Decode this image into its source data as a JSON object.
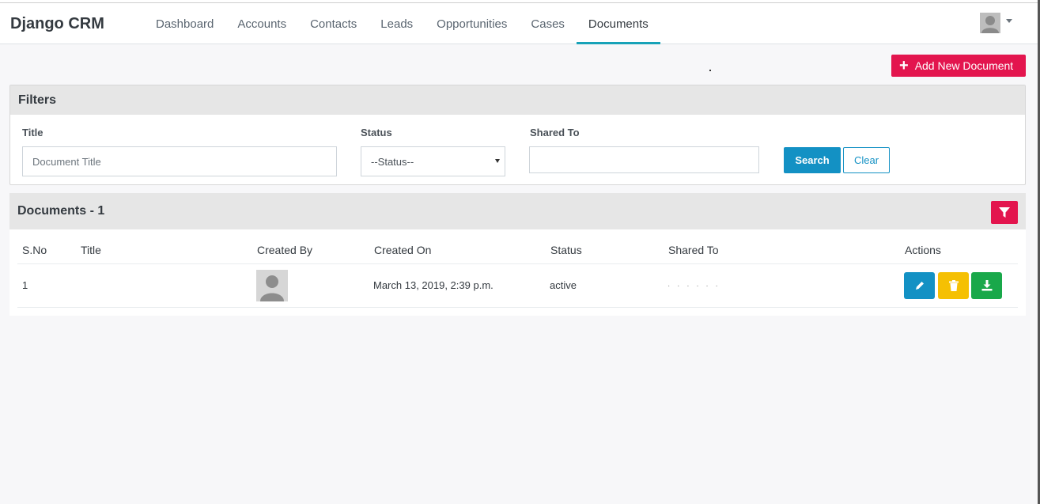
{
  "navbar": {
    "brand": "Django CRM",
    "items": [
      {
        "label": "Dashboard",
        "active": false
      },
      {
        "label": "Accounts",
        "active": false
      },
      {
        "label": "Contacts",
        "active": false
      },
      {
        "label": "Leads",
        "active": false
      },
      {
        "label": "Opportunities",
        "active": false
      },
      {
        "label": "Cases",
        "active": false
      },
      {
        "label": "Documents",
        "active": true
      }
    ]
  },
  "actions": {
    "add_document_label": "Add New Document",
    "add_icon": "plus-icon"
  },
  "filters": {
    "title": "Filters",
    "title_label": "Title",
    "title_placeholder": "Document Title",
    "status_label": "Status",
    "status_selected": "--Status--",
    "shared_to_label": "Shared To",
    "search_label": "Search",
    "clear_label": "Clear"
  },
  "documents": {
    "header": "Documents - 1",
    "columns": [
      "S.No",
      "Title",
      "Created By",
      "Created On",
      "Status",
      "Shared To",
      "Actions"
    ],
    "rows": [
      {
        "sno": "1",
        "title": "",
        "created_on": "March 13, 2019, 2:39 p.m.",
        "status": "active"
      }
    ]
  },
  "colors": {
    "accent": "#17a2b8",
    "danger": "#e3154e",
    "primary": "#1391c4",
    "warning": "#f5c003",
    "success": "#19a84a"
  }
}
